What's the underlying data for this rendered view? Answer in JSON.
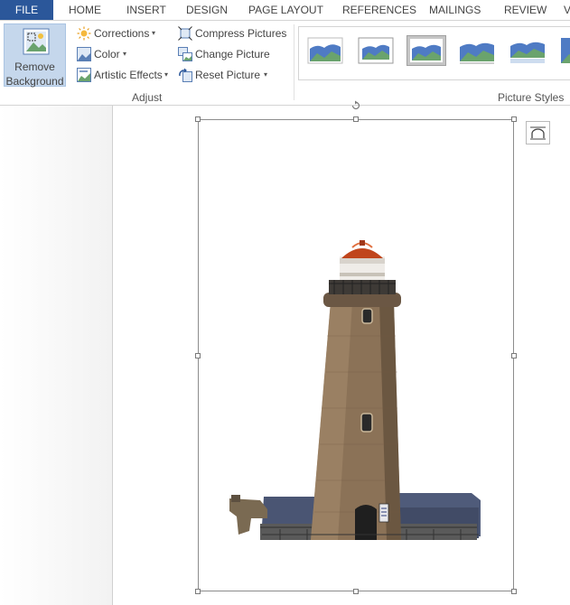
{
  "tabs": {
    "file": "FILE",
    "home": "HOME",
    "insert": "INSERT",
    "design": "DESIGN",
    "page_layout": "PAGE LAYOUT",
    "references": "REFERENCES",
    "mailings": "MAILINGS",
    "review": "REVIEW",
    "view_partial": "V"
  },
  "adjust": {
    "remove_background_line1": "Remove",
    "remove_background_line2": "Background",
    "corrections": "Corrections",
    "color": "Color",
    "artistic_effects": "Artistic Effects",
    "compress_pictures": "Compress Pictures",
    "change_picture": "Change Picture",
    "reset_picture": "Reset Picture",
    "group_label": "Adjust"
  },
  "picture_styles": {
    "group_label": "Picture Styles",
    "thumbnail_count": 6,
    "selected_index": 2
  },
  "colors": {
    "file_tab": "#2b579a",
    "active_button": "#c5d7ec",
    "sky": "#4f7bc4",
    "hill": "#6aa36d"
  }
}
